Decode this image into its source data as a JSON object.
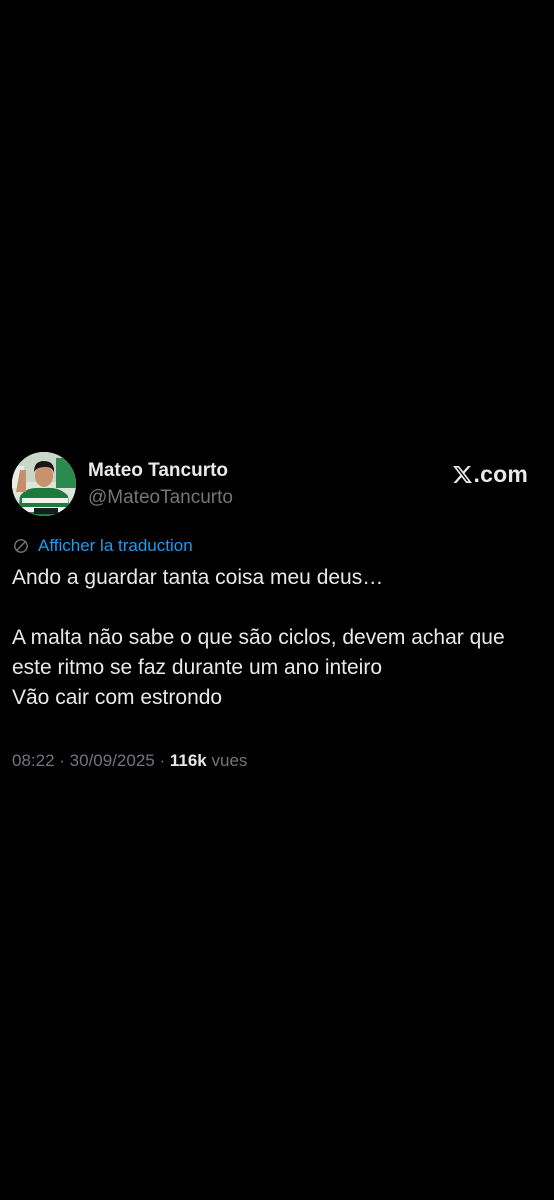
{
  "colors": {
    "background": "#000000",
    "text_primary": "#e7e9ea",
    "text_secondary": "#71767b",
    "link_blue": "#1d9bf0"
  },
  "author": {
    "display_name": "Mateo Tancurto",
    "handle": "@MateoTancurto",
    "avatar_icon": "profile-photo"
  },
  "brand": {
    "icon": "x-logo-icon",
    "text": ".com"
  },
  "translate": {
    "icon": "globe-icon",
    "label": "Afficher la traduction"
  },
  "tweet": {
    "text": "Ando a guardar tanta coisa meu deus…\n\nA malta não sabe o que são ciclos, devem achar que este ritmo se faz durante um ano inteiro\nVão cair com estrondo"
  },
  "meta": {
    "time": "08:22",
    "separator": " · ",
    "date": "30/09/2025",
    "views_count": "116k",
    "views_label": "vues"
  }
}
